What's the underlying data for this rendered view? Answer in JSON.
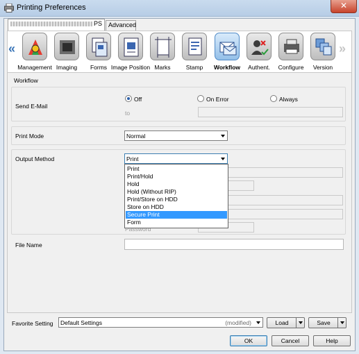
{
  "window": {
    "title": "Printing Preferences",
    "close_glyph": "✕",
    "icon": "printer-icon"
  },
  "tabs": [
    {
      "label": "PS",
      "active": true
    },
    {
      "label": "Advanced",
      "active": false
    }
  ],
  "toolbar": {
    "left_arrow": "«",
    "right_arrow": "»",
    "items": [
      {
        "label": "Management",
        "icon": "management-icon"
      },
      {
        "label": "Imaging",
        "icon": "imaging-icon"
      },
      {
        "label": "Forms",
        "icon": "forms-icon"
      },
      {
        "label": "Image Position",
        "icon": "image-position-icon"
      },
      {
        "label": "Marks",
        "icon": "marks-icon"
      },
      {
        "label": "Stamp",
        "icon": "stamp-icon"
      },
      {
        "label": "Workflow",
        "icon": "workflow-icon",
        "selected": true
      },
      {
        "label": "Authent.",
        "icon": "authentication-icon"
      },
      {
        "label": "Configure",
        "icon": "configure-icon"
      },
      {
        "label": "Version",
        "icon": "version-icon"
      }
    ]
  },
  "panel": {
    "title": "Workflow",
    "send_email": {
      "label": "Send E-Mail",
      "options": [
        "Off",
        "On Error",
        "Always"
      ],
      "selected": "Off",
      "to_label": "to",
      "to_value": ""
    },
    "print_mode": {
      "label": "Print Mode",
      "value": "Normal"
    },
    "output_method": {
      "label": "Output Method",
      "value": "Print",
      "options": [
        "Print",
        "Print/Hold",
        "Hold",
        "Hold (Without RIP)",
        "Print/Store on HDD",
        "Store on HDD",
        "Secure Print",
        "Form"
      ],
      "highlighted": "Secure Print",
      "partial_label": "Password",
      "partial_value": "••••••••"
    },
    "file_name": {
      "label": "File Name",
      "value": ""
    }
  },
  "footer": {
    "favorite_label": "Favorite Setting",
    "favorite_value": "Default Settings",
    "favorite_state": "(modified)",
    "load_label": "Load",
    "save_label": "Save",
    "ok_label": "OK",
    "cancel_label": "Cancel",
    "help_label": "Help"
  },
  "colors": {
    "accent": "#3399ff",
    "title_bar": "#c9dbee",
    "close": "#c7432b"
  }
}
